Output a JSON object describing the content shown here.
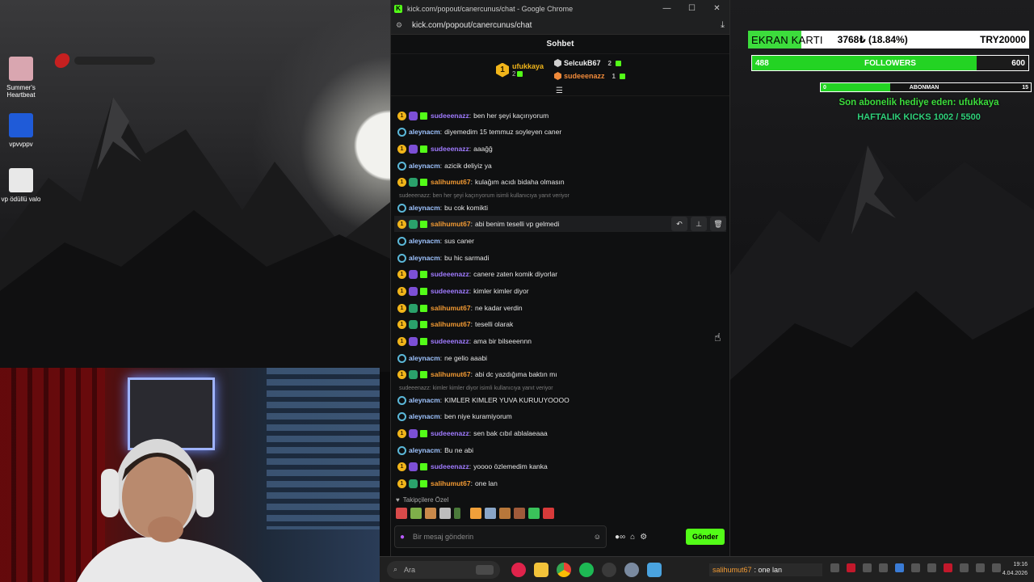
{
  "desktop": {
    "icons": [
      {
        "label": "Summer's Heartbeat",
        "color": "#d9a6b0"
      },
      {
        "label": "vpvvppv",
        "color": "#1f5bd8"
      },
      {
        "label": "vp ödüllü valo",
        "color": "#e8e8e8"
      }
    ]
  },
  "browser": {
    "title": "kick.com/popout/canercunus/chat - Google Chrome",
    "address": "kick.com/popout/canercunus/chat",
    "minimize": "—",
    "maximize": "☐",
    "close": "✕"
  },
  "chat": {
    "header": "Sohbet",
    "top_gifter": {
      "rank": "1",
      "name": "ufukkaya",
      "count": "2"
    },
    "gifters": [
      {
        "name": "SelcukB67",
        "count": "2"
      },
      {
        "name": "sudeeenazz",
        "count": "1"
      }
    ],
    "messages": [
      {
        "user": "sudeeenazz",
        "text": "ben her şeyi kaçırıyorum",
        "badges": "sub-purple-gift",
        "color": "purple"
      },
      {
        "user": "aleynacm",
        "text": "diyemedim 15 temmuz soyleyen caner",
        "badges": "swirl",
        "color": "blue"
      },
      {
        "user": "sudeeenazz",
        "text": "aaağğ",
        "badges": "sub-purple-gift",
        "color": "purple"
      },
      {
        "user": "aleynacm",
        "text": "azicik deliyiz ya",
        "badges": "swirl",
        "color": "blue"
      },
      {
        "user": "salihumut67",
        "text": "kulağım acıdı bidaha olmasın",
        "badges": "sub-green-gift",
        "color": "orange"
      },
      {
        "user": "aleynacm",
        "text": "bu cok komikti",
        "badges": "swirl",
        "color": "blue"
      },
      {
        "user": "salihumut67",
        "text": "abi benim teselli vp gelmedi",
        "badges": "sub-green-gift",
        "color": "orange"
      },
      {
        "user": "aleynacm",
        "text": "sus caner",
        "badges": "swirl",
        "color": "blue"
      },
      {
        "user": "aleynacm",
        "text": "bu hic sarmadi",
        "badges": "swirl",
        "color": "blue"
      },
      {
        "user": "sudeeenazz",
        "text": "canere zaten komik diyorlar",
        "badges": "sub-purple-gift",
        "color": "purple"
      },
      {
        "user": "sudeeenazz",
        "text": "kimler kimler diyor",
        "badges": "sub-purple-gift",
        "color": "purple"
      },
      {
        "user": "salihumut67",
        "text": "ne kadar verdin",
        "badges": "sub-green-gift",
        "color": "orange"
      },
      {
        "user": "salihumut67",
        "text": "teselli olarak",
        "badges": "sub-green-gift",
        "color": "orange"
      },
      {
        "user": "sudeeenazz",
        "text": "ama bir bilseeennn",
        "badges": "sub-purple-gift",
        "color": "purple"
      },
      {
        "user": "aleynacm",
        "text": "ne gelio aaabi",
        "badges": "swirl",
        "color": "blue"
      },
      {
        "user": "salihumut67",
        "text": "abi dc yazdığıma baktın mı",
        "badges": "sub-green-gift",
        "color": "orange"
      },
      {
        "user": "aleynacm",
        "text": "KIMLER KIMLER YUVA KURUUYOOOO",
        "badges": "swirl",
        "color": "blue"
      },
      {
        "user": "aleynacm",
        "text": "ben niye kuramiyorum",
        "badges": "swirl",
        "color": "blue"
      },
      {
        "user": "sudeeenazz",
        "text": "sen bak cıbıl ablalaeaaa",
        "badges": "sub-purple-gift",
        "color": "purple"
      },
      {
        "user": "aleynacm",
        "text": "Bu ne abi",
        "badges": "swirl",
        "color": "blue"
      },
      {
        "user": "sudeeenazz",
        "text": "yoooo özlemedim kanka",
        "badges": "sub-purple-gift",
        "color": "purple"
      },
      {
        "user": "salihumut67",
        "text": "one lan",
        "badges": "sub-green-gift",
        "color": "orange"
      }
    ],
    "replies": [
      {
        "text": "sudeeenazz: ben her şeyi kaçırıyorum isimli kullanıcıya yanıt veriyor"
      },
      {
        "text": "sudeeenazz: kimler kimler diyor isimli kullanıcıya yanıt veriyor"
      }
    ],
    "followers_only": "Takipçilere Özel",
    "input_placeholder": "Bir mesaj gönderin",
    "send_label": "Gönder"
  },
  "overlays": {
    "gpu": {
      "label": "EKRAN KARTI",
      "amount": "3768₺ (18.84%)",
      "goal": "TRY20000",
      "progress": 0.1884
    },
    "followers": {
      "current": "488",
      "label": "FOLLOWERS",
      "goal": "600",
      "progress": 0.813
    },
    "subs": {
      "current": "0",
      "label": "ABONMAN",
      "goal": "15",
      "progress": 0.33
    },
    "last_gift": "Son abonelik hediye eden: ufukkaya",
    "weekly_kicks": "HAFTALIK KICKS 1002 / 5500"
  },
  "taskbar": {
    "search_placeholder": "Ara",
    "ticker_user": "salihumut67",
    "ticker_text": ": one lan",
    "time": "19:16",
    "date": "4.04.2026"
  },
  "colors": {
    "kick_green": "#53fc18",
    "purple_user": "#a07bff",
    "orange_user": "#f29a33",
    "blue_user": "#9ec3ff"
  }
}
